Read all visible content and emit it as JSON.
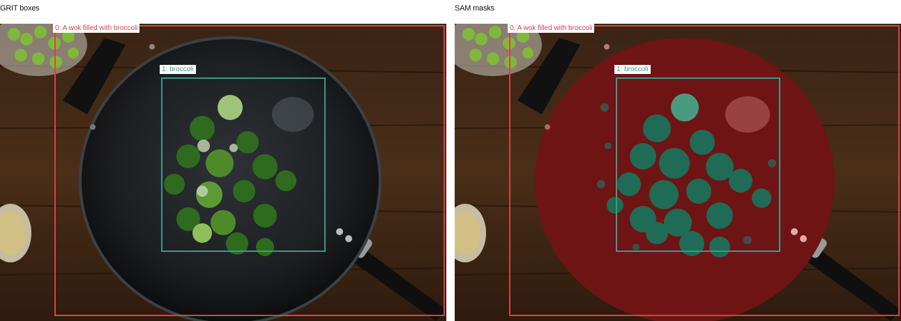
{
  "panels": {
    "left": {
      "title": "GRIT boxes"
    },
    "right": {
      "title": "SAM masks"
    }
  },
  "annotations": [
    {
      "index": "0",
      "label": "0: A wok filled with broccoli",
      "color": "#d9404a"
    },
    {
      "index": "1",
      "label": "1: broccoli",
      "color": "#3a9a8a"
    }
  ],
  "colors": {
    "mask_wok": "#6e1414",
    "mask_broccoli": "#1f6b55",
    "table": "#3b2414"
  },
  "icons": {
    "image": "photo-wok-broccoli"
  }
}
